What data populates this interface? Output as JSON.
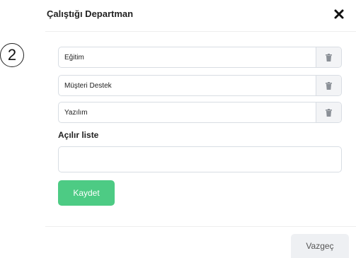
{
  "step_marker": "2",
  "modal": {
    "title": "Çalıştığı Departman"
  },
  "departments": [
    {
      "label": "Eğitim"
    },
    {
      "label": "Müşteri Destek"
    },
    {
      "label": "Yazılım"
    }
  ],
  "dropdown_field": {
    "label": "Açılır liste",
    "value": ""
  },
  "buttons": {
    "save": "Kaydet",
    "cancel": "Vazgeç"
  },
  "colors": {
    "save_button": "#4dcb84",
    "cancel_button": "#eef0f3"
  },
  "icons": {
    "close": "close-icon",
    "delete": "trash-icon"
  }
}
